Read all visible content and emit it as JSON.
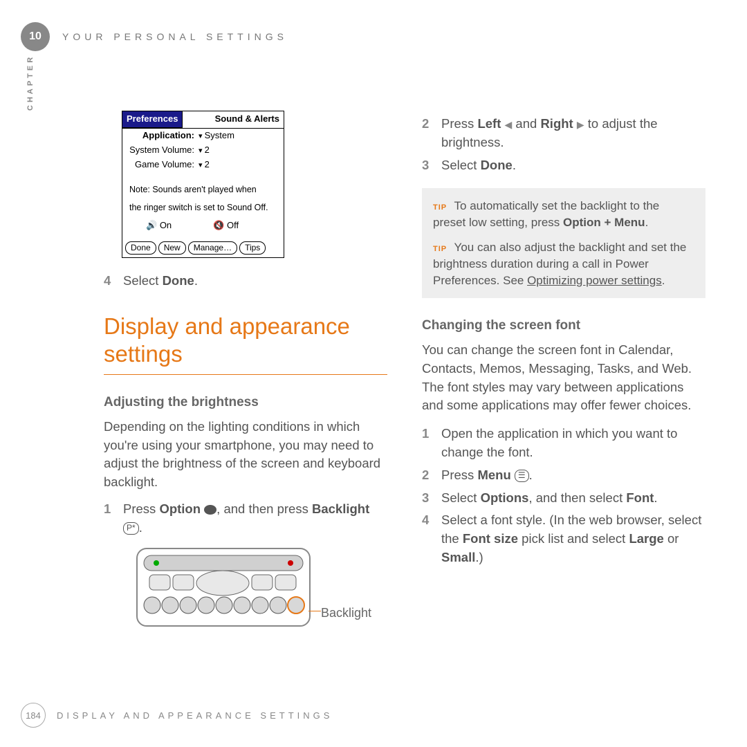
{
  "header": {
    "chapter_num": "10",
    "chapter_title": "YOUR PERSONAL SETTINGS",
    "side_tab": "CHAPTER"
  },
  "left": {
    "screenshot": {
      "title_left": "Preferences",
      "title_right": "Sound & Alerts",
      "rows": [
        {
          "label": "Application:",
          "value": "System",
          "bold": true
        },
        {
          "label": "System Volume:",
          "value": "2"
        },
        {
          "label": "Game Volume:",
          "value": "2"
        }
      ],
      "note1": "Note: Sounds aren't played when",
      "note2": "the ringer switch is set to Sound Off.",
      "on": "On",
      "off": "Off",
      "buttons": [
        "Done",
        "New",
        "Manage…",
        "Tips"
      ]
    },
    "step4": {
      "num": "4",
      "text_prefix": "Select ",
      "bold": "Done",
      "text_suffix": "."
    },
    "section_title": "Display and appearance settings",
    "sub1": "Adjusting the brightness",
    "para1": "Depending on the lighting conditions in which you're using your smartphone, you may need to adjust the brightness of the screen and keyboard backlight.",
    "step1": {
      "num": "1",
      "a": "Press ",
      "b": "Option",
      "c": " ",
      "d": ", and then press ",
      "e": "Backlight",
      "f": " ",
      "g": "."
    },
    "keypad_label": "Backlight"
  },
  "right": {
    "step2": {
      "num": "2",
      "a": "Press ",
      "b": "Left",
      "c": " ",
      "d": " and ",
      "e": "Right",
      "f": " ",
      "g": " to adjust the brightness."
    },
    "step3": {
      "num": "3",
      "a": "Select ",
      "b": "Done",
      "c": "."
    },
    "tip1": {
      "label": "TIP",
      "a": "To automatically set the backlight to the preset low setting, press ",
      "b": "Option + Menu",
      "c": "."
    },
    "tip2": {
      "label": "TIP",
      "a": "You can also adjust the backlight and set the brightness duration during a call in Power Preferences. See ",
      "link": "Optimizing power settings",
      "c": "."
    },
    "sub2": "Changing the screen font",
    "para2": "You can change the screen font in Calendar, Contacts, Memos, Messaging, Tasks, and Web. The font styles may vary between applications and some applications may offer fewer choices.",
    "s1": {
      "num": "1",
      "text": "Open the application in which you want to change the font."
    },
    "s2": {
      "num": "2",
      "a": "Press ",
      "b": "Menu",
      "c": " ",
      "d": "."
    },
    "s3": {
      "num": "3",
      "a": "Select ",
      "b": "Options",
      "c": ", and then select ",
      "d": "Font",
      "e": "."
    },
    "s4": {
      "num": "4",
      "a": "Select a font style. (In the web browser, select the ",
      "b": "Font size",
      "c": " pick list and select ",
      "d": "Large",
      "e": " or ",
      "f": "Small",
      "g": ".)"
    }
  },
  "footer": {
    "page": "184",
    "title": "DISPLAY AND APPEARANCE SETTINGS"
  }
}
